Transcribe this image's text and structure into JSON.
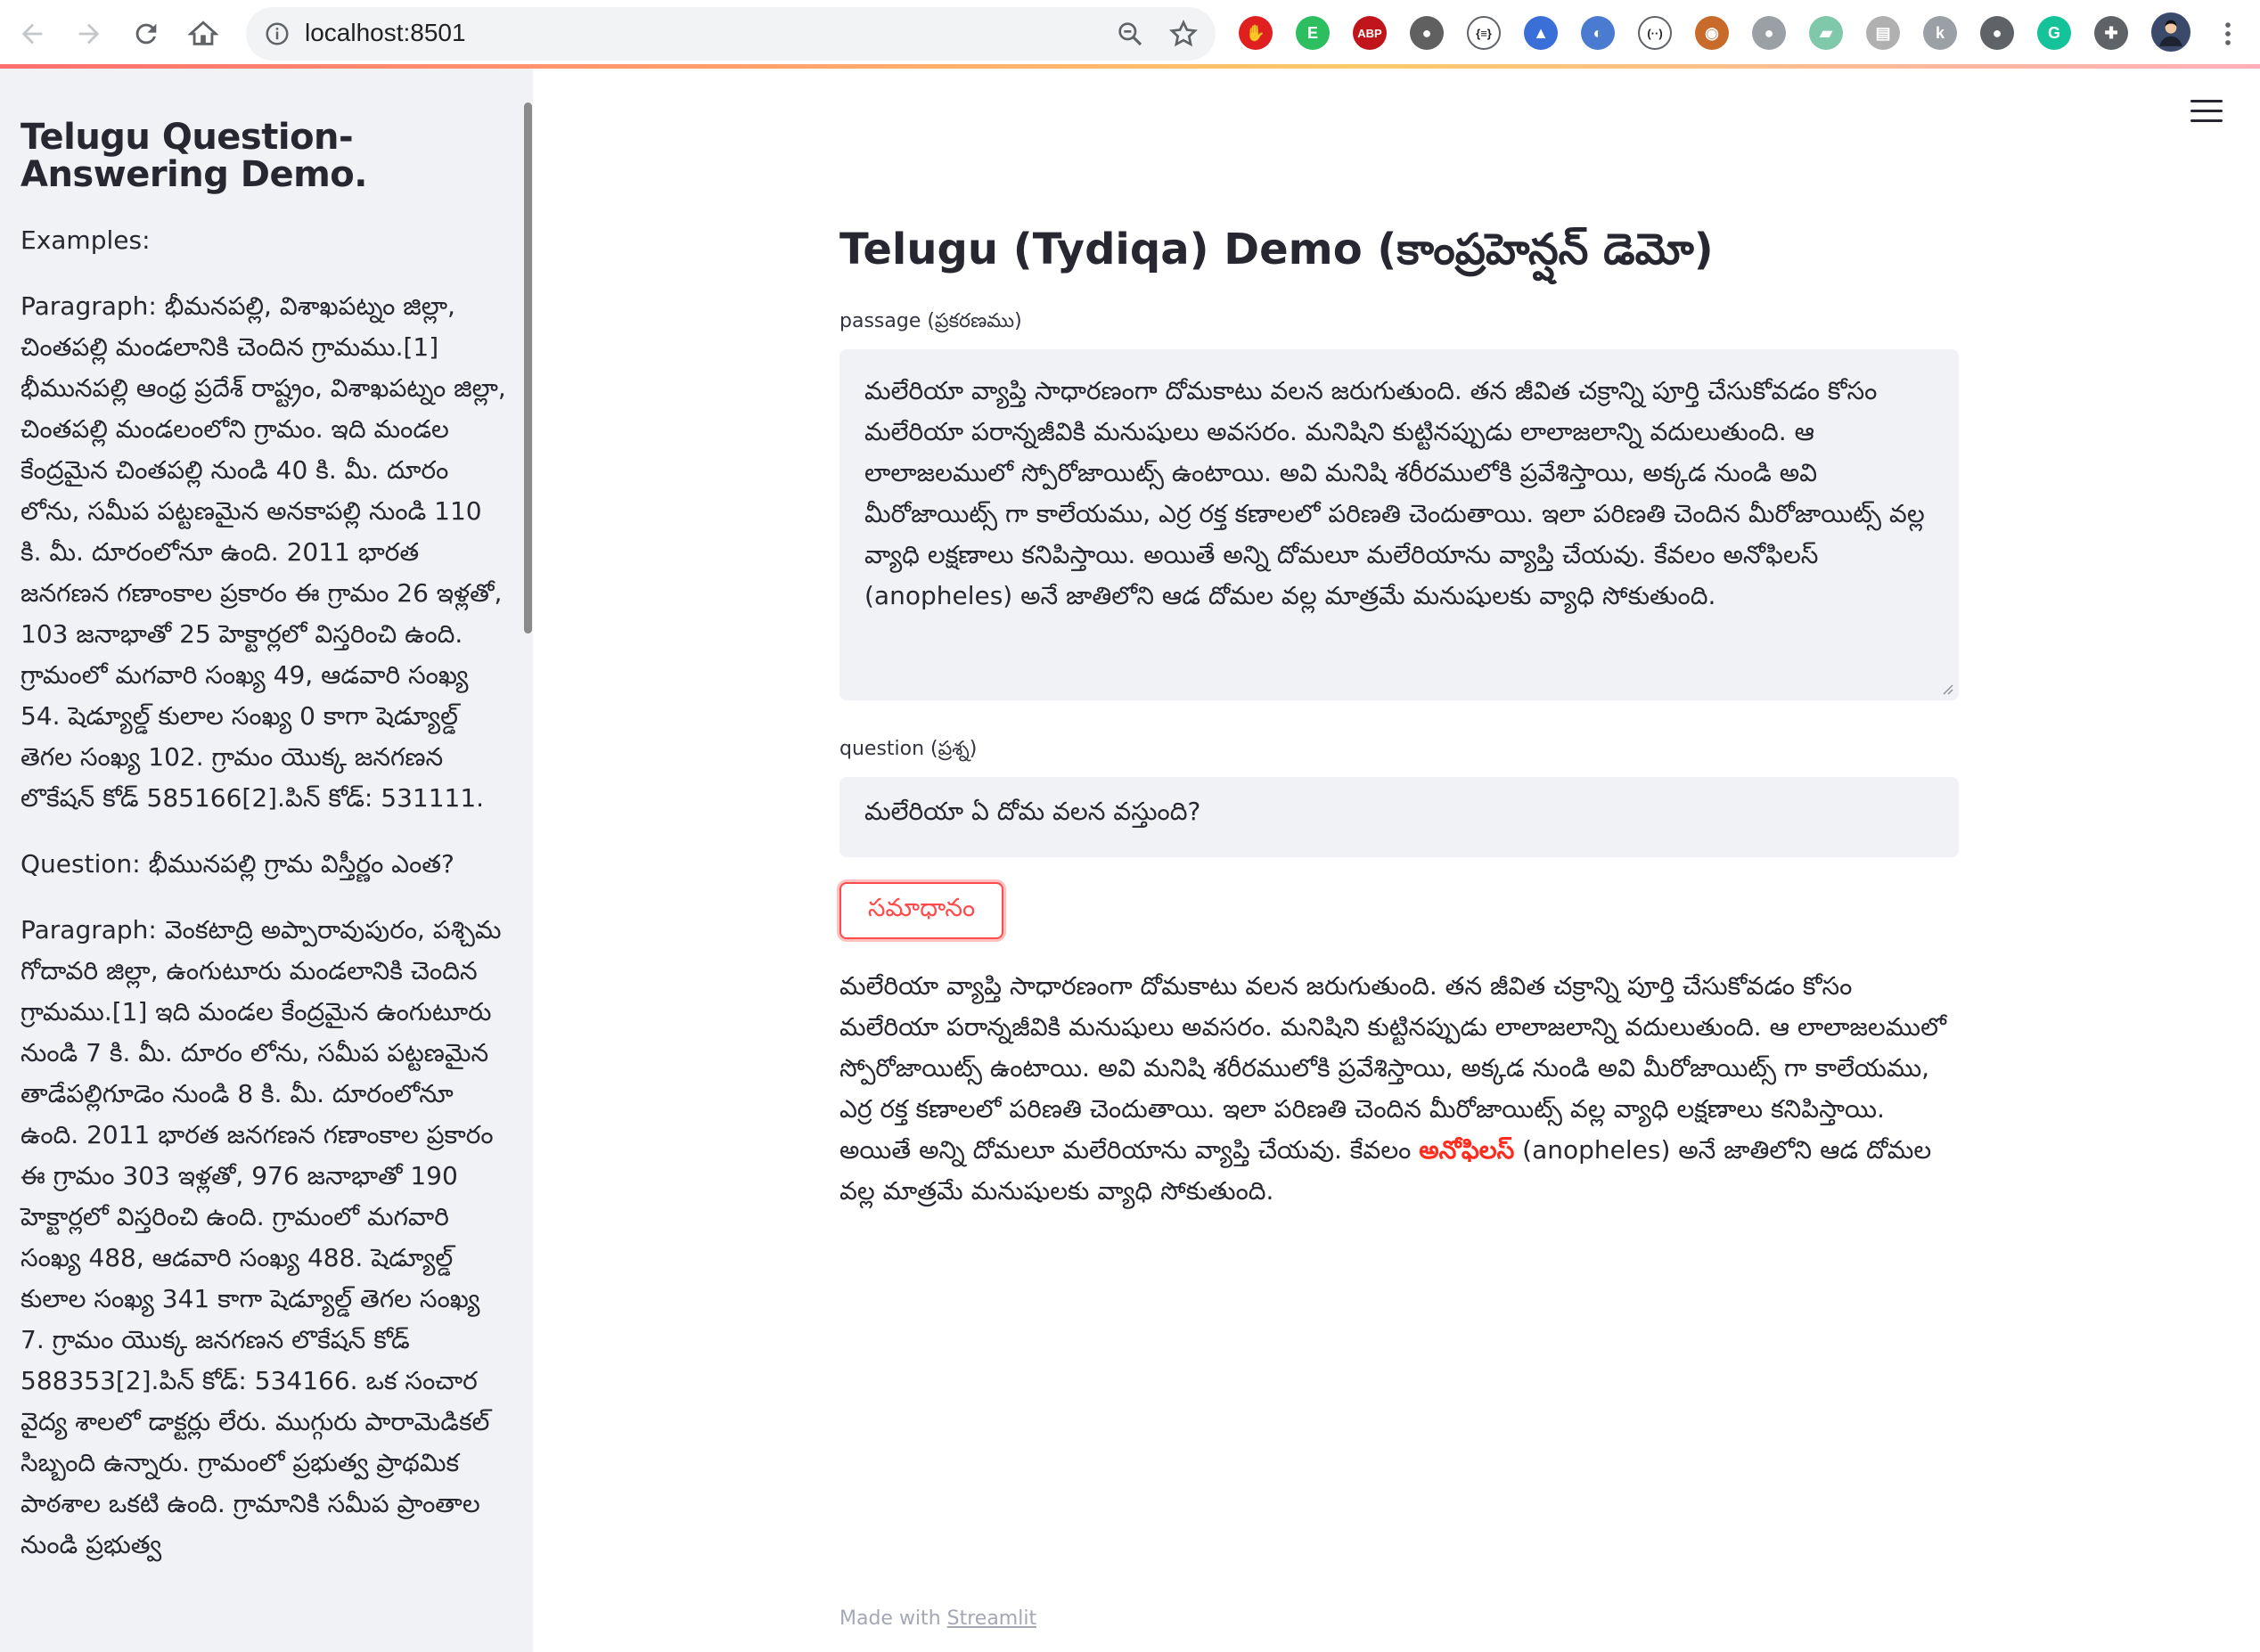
{
  "browser": {
    "url": "localhost:8501"
  },
  "extensions": [
    {
      "name": "stop-icon",
      "glyph": "✋",
      "color": "#e02020"
    },
    {
      "name": "evernote-icon",
      "glyph": "E",
      "color": "#2dbe60"
    },
    {
      "name": "adblock-icon",
      "glyph": "ABP",
      "color": "#c0161b"
    },
    {
      "name": "circle-extension-icon",
      "glyph": "●",
      "color": "#606060"
    },
    {
      "name": "json-extension-icon",
      "glyph": "{≡}",
      "color": "#ffffff"
    },
    {
      "name": "graduation-cap-icon",
      "glyph": "▲",
      "color": "#3a6fd8"
    },
    {
      "name": "swirl-extension-icon",
      "glyph": "◐",
      "color": "#4a7bd0"
    },
    {
      "name": "code-extension-icon",
      "glyph": "(··)",
      "color": "#ffffff"
    },
    {
      "name": "owl-extension-icon",
      "glyph": "◉",
      "color": "#c86a2a"
    },
    {
      "name": "chat-bubble-icon",
      "glyph": "●",
      "color": "#9aa0a6"
    },
    {
      "name": "image-extension-icon",
      "glyph": "▰",
      "color": "#7fc8a9"
    },
    {
      "name": "document-extension-icon",
      "glyph": "▤",
      "color": "#b0b0b0"
    },
    {
      "name": "k-extension-icon",
      "glyph": "k",
      "color": "#9aa0a6"
    },
    {
      "name": "lightbulb-icon",
      "glyph": "●",
      "color": "#5f6368"
    },
    {
      "name": "grammarly-icon",
      "glyph": "G",
      "color": "#15c39a"
    },
    {
      "name": "puzzle-icon",
      "glyph": "✚",
      "color": "#5f6368"
    }
  ],
  "sidebar": {
    "title": "Telugu Question-Answering Demo.",
    "examples_label": "Examples:",
    "example1_paragraph": "Paragraph: భీమనపల్లి, విశాఖపట్నం జిల్లా, చింతపల్లి మండలానికి చెందిన గ్రామము.[1] భీమునపల్లి ఆంధ్ర ప్రదేశ్ రాష్ట్రం, విశాఖపట్నం జిల్లా, చింతపల్లి మండలంలోని గ్రామం. ఇది మండల కేంద్రమైన చింతపల్లి నుండి 40 కి. మీ. దూరం లోను, సమీప పట్టణమైన అనకాపల్లి నుండి 110 కి. మీ. దూరంలోనూ ఉంది. 2011 భారత జనగణన గణాంకాల ప్రకారం ఈ గ్రామం 26 ఇళ్లతో, 103 జనాభాతో 25 హెక్టార్లలో విస్తరించి ఉంది. గ్రామంలో మగవారి సంఖ్య 49, ఆడవారి సంఖ్య 54. షెడ్యూల్డ్ కులాల సంఖ్య 0 కాగా షెడ్యూల్డ్ తెగల సంఖ్య 102. గ్రామం యొక్క జనగణన లొకేషన్ కోడ్ 585166[2].పిన్ కోడ్: 531111.",
    "example1_question": "Question: భీమునపల్లి గ్రామ విస్తీర్ణం ఎంత?",
    "example2_paragraph": "Paragraph: వెంకటాద్రి అప్పారావుపురం, పశ్చిమ గోదావరి జిల్లా, ఉంగుటూరు మండలానికి చెందిన గ్రామము.[1] ఇది మండల కేంద్రమైన ఉంగుటూరు నుండి 7 కి. మీ. దూరం లోను, సమీప పట్టణమైన తాడేపల్లిగూడెం నుండి 8 కి. మీ. దూరంలోనూ ఉంది. 2011 భారత జనగణన గణాంకాల ప్రకారం ఈ గ్రామం 303 ఇళ్లతో, 976 జనాభాతో 190 హెక్టార్లలో విస్తరించి ఉంది. గ్రామంలో మగవారి సంఖ్య 488, ఆడవారి సంఖ్య 488. షెడ్యూల్డ్ కులాల సంఖ్య 341 కాగా షెడ్యూల్డ్ తెగల సంఖ్య 7. గ్రామం యొక్క జనగణన లొకేషన్ కోడ్ 588353[2].పిన్ కోడ్: 534166. ఒక సంచార వైద్య శాలలో డాక్టర్లు లేరు. ముగ్గురు పారామెడికల్ సిబ్బంది ఉన్నారు. గ్రామంలో ప్రభుత్వ ప్రాథమిక పాఠశాల ఒకటి ఉంది. గ్రామానికి సమీప ప్రాంతాల నుండి ప్రభుత్వ"
  },
  "main": {
    "title": "Telugu (Tydiqa) Demo (కాంప్రహెన్షన్ డెమో)",
    "passage_label": "passage (ప్రకరణము)",
    "passage_value": "మలేరియా వ్యాప్తి సాధారణంగా దోమకాటు వలన జరుగుతుంది. తన జీవిత చక్రాన్ని పూర్తి చేసుకోవడం కోసం మలేరియా పరాన్నజీవికి మనుషులు అవసరం. మనిషిని కుట్టినప్పుడు లాలాజలాన్ని వదులుతుంది. ఆ లాలాజలములో స్పోరోజాయిట్స్ ఉంటాయి. అవి మనిషి శరీరములోకి ప్రవేశిస్తాయి, అక్కడ నుండి అవి మీరోజాయిట్స్ గా కాలేయము, ఎర్ర రక్త కణాలలో పరిణతి చెందుతాయి. ఇలా పరిణతి చెందిన మీరోజాయిట్స్ వల్ల వ్యాధి లక్షణాలు కనిపిస్తాయి. అయితే అన్ని దోమలూ మలేరియాను వ్యాప్తి చేయవు. కేవలం అనోఫిలస్ (anopheles)  అనే జాతిలోని ఆడ దోమల వల్ల మాత్రమే మనుషులకు వ్యాధి సోకుతుంది.",
    "question_label": "question (ప్రశ్న)",
    "question_value": "మలేరియా ఏ దోమ వలన వస్తుంది?",
    "answer_button": "సమాధానం",
    "answer_before": "మలేరియా వ్యాప్తి సాధారణంగా దోమకాటు వలన జరుగుతుంది. తన జీవిత చక్రాన్ని పూర్తి చేసుకోవడం కోసం మలేరియా పరాన్నజీవికి మనుషులు అవసరం. మనిషిని కుట్టినప్పుడు లాలాజలాన్ని వదులుతుంది. ఆ లాలాజలములో స్పోరోజాయిట్స్ ఉంటాయి. అవి మనిషి శరీరములోకి ప్రవేశిస్తాయి, అక్కడ నుండి అవి మీరోజాయిట్స్ గా కాలేయము, ఎర్ర రక్త కణాలలో పరిణతి చెందుతాయి. ఇలా పరిణతి చెందిన మీరోజాయిట్స్ వల్ల వ్యాధి లక్షణాలు కనిపిస్తాయి. అయితే అన్ని దోమలూ మలేరియాను వ్యాప్తి చేయవు. కేవలం ",
    "answer_highlight": "అనోఫిలస్",
    "answer_after": " (anopheles) అనే జాతిలోని ఆడ దోమల వల్ల మాత్రమే మనుషులకు వ్యాధి సోకుతుంది.",
    "highlight_color": "#ff2b1c"
  },
  "footer": {
    "made_with": "Made with ",
    "link": "Streamlit"
  },
  "theme": {
    "accent": "#ff4b4b",
    "sidebar_bg": "#f0f2f6"
  }
}
